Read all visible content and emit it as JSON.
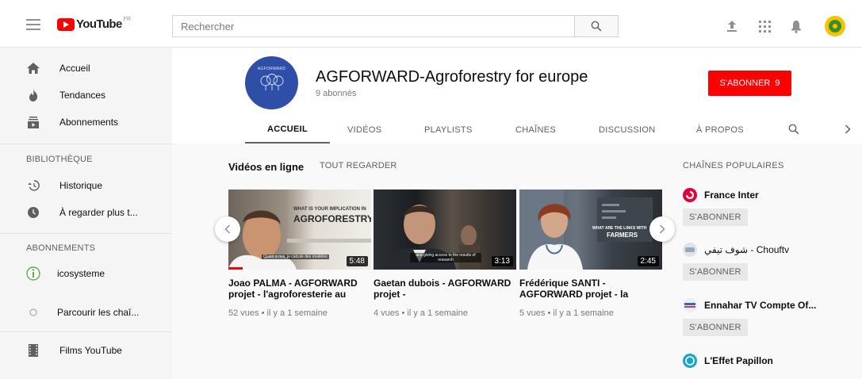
{
  "topbar": {
    "logo_text": "YouTube",
    "logo_country": "FR",
    "search_placeholder": "Rechercher"
  },
  "sidebar": {
    "main_items": [
      {
        "label": "Accueil",
        "icon": "home-icon"
      },
      {
        "label": "Tendances",
        "icon": "flame-icon"
      },
      {
        "label": "Abonnements",
        "icon": "subscriptions-icon"
      }
    ],
    "library_header": "BIBLIOTHÈQUE",
    "library_items": [
      {
        "label": "Historique",
        "icon": "history-icon"
      },
      {
        "label": "À regarder plus t...",
        "icon": "clock-icon"
      }
    ],
    "subscriptions_header": "ABONNEMENTS",
    "subscription_items": [
      {
        "label": "icosysteme",
        "icon": "channel-avatar-icon"
      },
      {
        "label": "Parcourir les chaî...",
        "icon": "browse-channels-icon"
      }
    ],
    "extra_items": [
      {
        "label": "Films YouTube",
        "icon": "film-icon"
      }
    ]
  },
  "channel": {
    "name": "AGFORWARD-Agroforestry for europe",
    "subscribers": "9 abonnés",
    "avatar_text": "AGFORWARD",
    "subscribe_label": "S'ABONNER",
    "subscribe_count": "9",
    "tabs": [
      "ACCUEIL",
      "VIDÉOS",
      "PLAYLISTS",
      "CHAÎNES",
      "DISCUSSION",
      "À PROPOS"
    ]
  },
  "section": {
    "title": "Vidéos en ligne",
    "link": "TOUT REGARDER"
  },
  "videos": [
    {
      "title": "Joao PALMA - AGFORWARD projet - l'agroforesterie au",
      "views": "52 vues",
      "age": "il y a 1 semaine",
      "duration": "5:48",
      "thumb_caption_big": "AGROFORESTRY?",
      "thumb_caption_small": "WHAT IS YOUR IMPLICATION IN",
      "thumb_subtitle": "Quant à moi, je calcule des modèles",
      "progress": 0.1
    },
    {
      "title": "Gaetan dubois - AGFORWARD projet -",
      "views": "4 vues",
      "age": "il y a 1 semaine",
      "duration": "3:13",
      "thumb_subtitle": "and giving access to the results of research"
    },
    {
      "title": "Frédérique SANTI - AGFORWARD projet - la",
      "views": "5 vues",
      "age": "il y a 1 semaine",
      "duration": "2:45",
      "thumb_caption_small": "WHAT ARE THE LINKS WITH",
      "thumb_caption_big": "FARMERS"
    }
  ],
  "meta_separator": "•",
  "popular": {
    "title": "CHAÎNES POPULAIRES",
    "channels": [
      {
        "name": "France Inter",
        "icon": "france-inter-icon",
        "color": "#e4003a",
        "subscribe_label": "S'ABONNER"
      },
      {
        "name": "شوف تيفي - Chouftv",
        "icon": "chouftv-icon",
        "color": "#9aa7b8",
        "subscribe_label": "S'ABONNER"
      },
      {
        "name": "Ennahar TV Compte Of...",
        "icon": "ennahar-icon",
        "color": "#3a63b5",
        "subscribe_label": "S'ABONNER"
      },
      {
        "name": "L'Effet Papillon",
        "icon": "effet-papillon-icon",
        "color": "#1ba5c8"
      }
    ]
  },
  "colors": {
    "brand_red": "#ff0000",
    "channel_avatar_bg": "#2f4ea8"
  }
}
